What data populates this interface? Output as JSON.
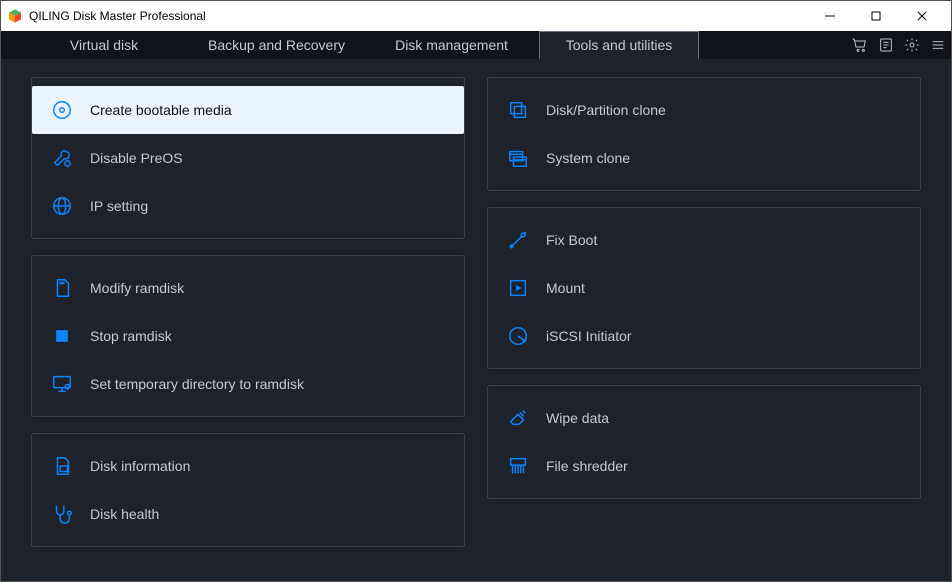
{
  "titlebar": {
    "title": "QILING Disk Master Professional"
  },
  "tabs": {
    "t1": "Virtual disk",
    "t2": "Backup and Recovery",
    "t3": "Disk management",
    "t4": "Tools and utilities"
  },
  "left": {
    "g1": {
      "i1": "Create bootable media",
      "i2": "Disable PreOS",
      "i3": "IP setting"
    },
    "g2": {
      "i1": "Modify ramdisk",
      "i2": "Stop ramdisk",
      "i3": "Set temporary directory to ramdisk"
    },
    "g3": {
      "i1": "Disk information",
      "i2": "Disk health"
    }
  },
  "right": {
    "g1": {
      "i1": "Disk/Partition clone",
      "i2": "System clone"
    },
    "g2": {
      "i1": "Fix Boot",
      "i2": "Mount",
      "i3": "iSCSI Initiator"
    },
    "g3": {
      "i1": "Wipe data",
      "i2": "File shredder"
    }
  }
}
